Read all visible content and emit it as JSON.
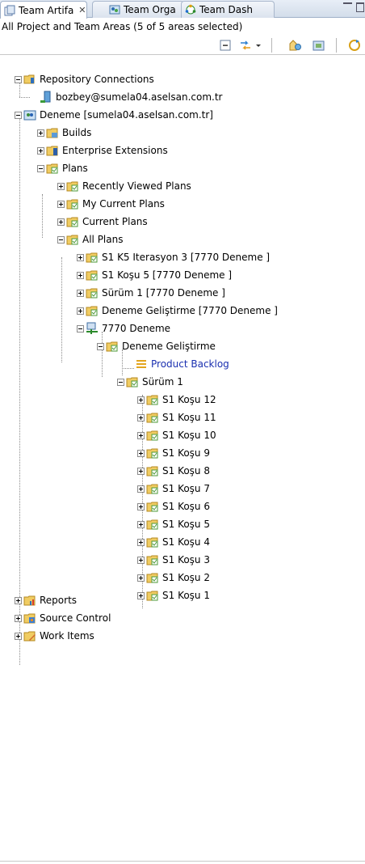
{
  "tabs": [
    {
      "label": "Team Artifa",
      "close": "✕",
      "active": true
    },
    {
      "label": "Team Orga",
      "active": false
    },
    {
      "label": "Team Dash",
      "active": false
    }
  ],
  "summary": "All Project and Team Areas (5 of 5 areas selected)",
  "tree": {
    "repository_connections": "Repository Connections",
    "connection": "bozbey@sumela04.aselsan.com.tr",
    "project": "Deneme [sumela04.aselsan.com.tr]",
    "builds": "Builds",
    "enterprise_extensions": "Enterprise Extensions",
    "plans": "Plans",
    "recently_viewed_plans": "Recently Viewed Plans",
    "my_current_plans": "My Current Plans",
    "current_plans": "Current Plans",
    "all_plans": "All Plans",
    "plan_s1k5": "S1 K5 Iterasyon 3 [7770 Deneme ]",
    "plan_s1kosu5": "S1 Koşu 5 [7770 Deneme ]",
    "plan_surum1": "Sürüm 1 [7770 Deneme ]",
    "plan_deneme_gelistirme": "Deneme Geliştirme [7770 Deneme ]",
    "team_7770": "7770 Deneme",
    "deneme_gelistirme": "Deneme Geliştirme",
    "product_backlog": "Product Backlog",
    "surum1": "Sürüm 1",
    "kosu": [
      "S1 Koşu 12",
      "S1 Koşu 11",
      "S1 Koşu 10",
      "S1 Koşu 9",
      "S1 Koşu 8",
      "S1 Koşu 7",
      "S1 Koşu 6",
      "S1 Koşu 5",
      "S1 Koşu 4",
      "S1 Koşu 3",
      "S1 Koşu 2",
      "S1 Koşu 1"
    ],
    "reports": "Reports",
    "source_control": "Source Control",
    "work_items": "Work Items"
  },
  "icons": {
    "tab1": "team-artifacts-icon",
    "tab2": "team-organization-icon",
    "tab3": "team-dashboard-icon",
    "folder": "folder-icon",
    "plan": "plan-folder-icon",
    "colors": {
      "folder": "#e8c25a",
      "plan_badge": "#4c9a3a",
      "link": "#1a2fb0"
    }
  }
}
